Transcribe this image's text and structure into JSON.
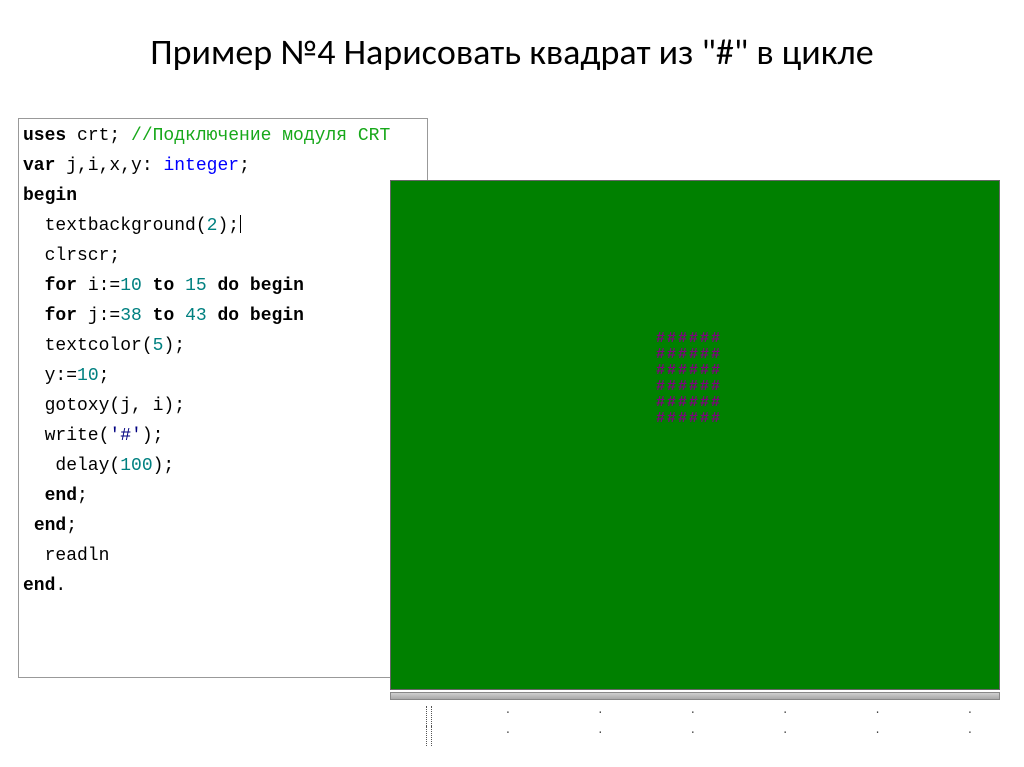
{
  "title": "Пример №4 Нарисовать квадрат из \"#\" в цикле",
  "code": {
    "l1_kw": "uses",
    "l1_txt": " crt; ",
    "l1_cm": "//Подключение модуля CRT",
    "l2_kw": "var",
    "l2_txt": " j,i,x,y: ",
    "l2_ty": "integer",
    "l2_end": ";",
    "l3_kw": "begin",
    "l4_txt": "  textbackground(",
    "l4_num": "2",
    "l4_end": ");",
    "l5_txt": "  clrscr;",
    "l6_ind": "  ",
    "l6_for": "for",
    "l6_txt1": " i:=",
    "l6_n1": "10",
    "l6_to": " to ",
    "l6_n2": "15",
    "l6_sp": " ",
    "l6_do": "do begin",
    "l7_ind": "  ",
    "l7_for": "for",
    "l7_txt1": " j:=",
    "l7_n1": "38",
    "l7_to": " to ",
    "l7_n2": "43",
    "l7_sp": " ",
    "l7_do": "do begin",
    "l8_txt": "  textcolor(",
    "l8_num": "5",
    "l8_end": ");",
    "l9_txt": "  y:=",
    "l9_num": "10",
    "l9_end": ";",
    "l10_txt": "  gotoxy(j, i);",
    "l11_txt": "  write(",
    "l11_str": "'#'",
    "l11_end": ");",
    "l12_txt": "   delay(",
    "l12_num": "100",
    "l12_end": ");",
    "l13_ind": "  ",
    "l13_kw": "end",
    "l13_end": ";",
    "l14_ind": " ",
    "l14_kw": "end",
    "l14_end": ";",
    "l15_txt": "  readln",
    "l16_kw": "end",
    "l16_end": "."
  },
  "console": {
    "hash_row": "######"
  }
}
